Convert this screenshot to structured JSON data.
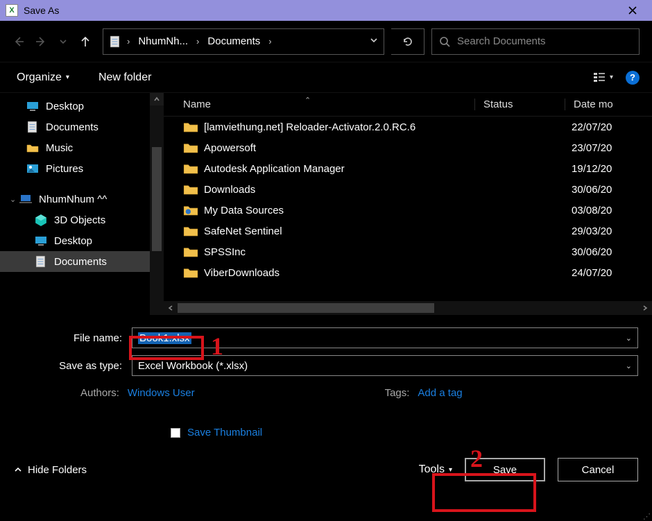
{
  "title": "Save As",
  "breadcrumb": {
    "part1": "NhumNh...",
    "part2": "Documents"
  },
  "search": {
    "placeholder": "Search Documents"
  },
  "toolbar": {
    "organize": "Organize",
    "newfolder": "New folder"
  },
  "sidebar": {
    "items": [
      {
        "label": "Desktop",
        "type": "screen"
      },
      {
        "label": "Documents",
        "type": "doc"
      },
      {
        "label": "Music",
        "type": "folder"
      },
      {
        "label": "Pictures",
        "type": "pic"
      }
    ],
    "computer": "NhumNhum ^^",
    "subitems": [
      {
        "label": "3D Objects",
        "type": "cube"
      },
      {
        "label": "Desktop",
        "type": "screen"
      },
      {
        "label": "Documents",
        "type": "doc",
        "selected": true
      }
    ]
  },
  "columns": {
    "name": "Name",
    "status": "Status",
    "date": "Date mo"
  },
  "files": [
    {
      "name": "[lamviethung.net] Reloader-Activator.2.0.RC.6",
      "date": "22/07/20",
      "type": "folder"
    },
    {
      "name": "Apowersoft",
      "date": "23/07/20",
      "type": "folder"
    },
    {
      "name": "Autodesk Application Manager",
      "date": "19/12/20",
      "type": "folder"
    },
    {
      "name": "Downloads",
      "date": "30/06/20",
      "type": "folder"
    },
    {
      "name": "My Data Sources",
      "date": "03/08/20",
      "type": "special"
    },
    {
      "name": "SafeNet Sentinel",
      "date": "29/03/20",
      "type": "folder"
    },
    {
      "name": "SPSSInc",
      "date": "30/06/20",
      "type": "folder"
    },
    {
      "name": "ViberDownloads",
      "date": "24/07/20",
      "type": "folder"
    }
  ],
  "form": {
    "filename_label": "File name:",
    "filename_value": "Book1.xlsx",
    "saveastype_label": "Save as type:",
    "saveastype_value": "Excel Workbook (*.xlsx)"
  },
  "meta": {
    "authors_label": "Authors:",
    "authors_value": "Windows User",
    "tags_label": "Tags:",
    "tags_value": "Add a tag",
    "thumbnail": "Save Thumbnail"
  },
  "footer": {
    "hide": "Hide Folders",
    "tools": "Tools",
    "save": "Save",
    "cancel": "Cancel"
  },
  "annotations": {
    "n1": "1",
    "n2": "2"
  }
}
